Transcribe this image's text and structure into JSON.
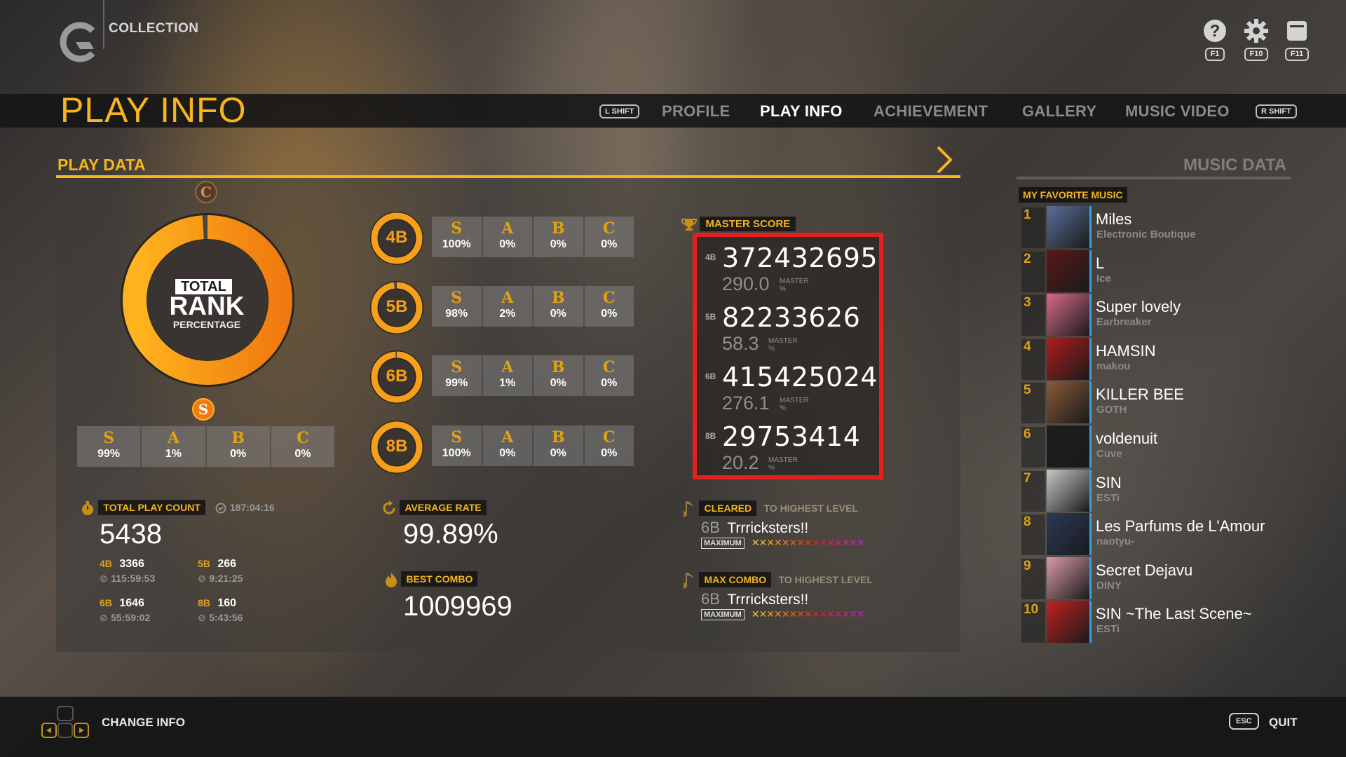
{
  "header": {
    "app_section": "COLLECTION",
    "page_title": "PLAY INFO",
    "hud": [
      {
        "icon": "help-icon",
        "key": "F1"
      },
      {
        "icon": "gear-icon",
        "key": "F10"
      },
      {
        "icon": "window-icon",
        "key": "F11"
      }
    ]
  },
  "nav": {
    "left_key": "L SHIFT",
    "right_key": "R SHIFT",
    "tabs": [
      "PROFILE",
      "PLAY INFO",
      "ACHIEVEMENT",
      "GALLERY",
      "MUSIC VIDEO"
    ],
    "active_tab": "PLAY INFO"
  },
  "play_data": {
    "title": "PLAY DATA",
    "total_rank": {
      "label_total": "TOTAL",
      "label_rank": "RANK",
      "label_percentage": "PERCENTAGE",
      "ring_fill_fraction": 0.99,
      "grades": [
        {
          "grade": "S",
          "pct": "99%"
        },
        {
          "grade": "A",
          "pct": "1%"
        },
        {
          "grade": "B",
          "pct": "0%"
        },
        {
          "grade": "C",
          "pct": "0%"
        }
      ]
    },
    "buttons": [
      {
        "mode": "4B",
        "fill": 1.0,
        "grades": [
          "100%",
          "0%",
          "0%",
          "0%"
        ]
      },
      {
        "mode": "5B",
        "fill": 0.98,
        "grades": [
          "98%",
          "2%",
          "0%",
          "0%"
        ]
      },
      {
        "mode": "6B",
        "fill": 0.99,
        "grades": [
          "99%",
          "1%",
          "0%",
          "0%"
        ]
      },
      {
        "mode": "8B",
        "fill": 1.0,
        "grades": [
          "100%",
          "0%",
          "0%",
          "0%"
        ]
      }
    ],
    "grade_letters": [
      "S",
      "A",
      "B",
      "C"
    ],
    "master_score": {
      "label": "MASTER SCORE",
      "rows": [
        {
          "mode": "4B",
          "score": "372432695",
          "level": "290.0",
          "tag": "MASTER",
          "unit": "%"
        },
        {
          "mode": "5B",
          "score": "82233626",
          "level": "58.3",
          "tag": "MASTER",
          "unit": "%"
        },
        {
          "mode": "6B",
          "score": "415425024",
          "level": "276.1",
          "tag": "MASTER",
          "unit": "%"
        },
        {
          "mode": "8B",
          "score": "29753414",
          "level": "20.2",
          "tag": "MASTER",
          "unit": "%"
        }
      ]
    },
    "total_play_count": {
      "label": "TOTAL PLAY COUNT",
      "total_time": "187:04:16",
      "value": "5438",
      "breakdown": [
        {
          "mode": "4B",
          "count": "3366",
          "time": "115:59:53"
        },
        {
          "mode": "5B",
          "count": "266",
          "time": "9:21:25"
        },
        {
          "mode": "6B",
          "count": "1646",
          "time": "55:59:02"
        },
        {
          "mode": "8B",
          "count": "160",
          "time": "5:43:56"
        }
      ]
    },
    "average_rate": {
      "label": "AVERAGE RATE",
      "value": "99.89%"
    },
    "best_combo": {
      "label": "BEST COMBO",
      "value": "1009969"
    },
    "cleared": {
      "label": "CLEARED",
      "sub": "TO HIGHEST LEVEL",
      "mode": "6B",
      "song": "Trrricksters!!",
      "difficulty": "MAXIMUM",
      "stars": 15
    },
    "max_combo": {
      "label": "MAX COMBO",
      "sub": "TO HIGHEST LEVEL",
      "mode": "6B",
      "song": "Trrricksters!!",
      "difficulty": "MAXIMUM",
      "stars": 15
    }
  },
  "music_data": {
    "title": "MUSIC DATA",
    "favorite_label": "MY FAVORITE MUSIC",
    "items": [
      {
        "rank": "1",
        "title": "Miles",
        "artist": "Electronic Boutique",
        "color": "#5a6f9a"
      },
      {
        "rank": "2",
        "title": "L",
        "artist": "Ice",
        "color": "#5a1818"
      },
      {
        "rank": "3",
        "title": "Super lovely",
        "artist": "Earbreaker",
        "color": "#d86a8a"
      },
      {
        "rank": "4",
        "title": "HAMSIN",
        "artist": "makou",
        "color": "#b01c1c"
      },
      {
        "rank": "5",
        "title": "KILLER BEE",
        "artist": "GOTH",
        "color": "#8a5a3a"
      },
      {
        "rank": "6",
        "title": "voldenuit",
        "artist": "Cuve",
        "color": "#1e1e1e"
      },
      {
        "rank": "7",
        "title": "SIN",
        "artist": "ESTi",
        "color": "#c8c8c8"
      },
      {
        "rank": "8",
        "title": "Les Parfums de L'Amour",
        "artist": "naotyu-",
        "color": "#2a3a5a"
      },
      {
        "rank": "9",
        "title": "Secret Dejavu",
        "artist": "DINY",
        "color": "#d89aa8"
      },
      {
        "rank": "10",
        "title": "SIN ~The Last Scene~",
        "artist": "ESTi",
        "color": "#c42020"
      }
    ]
  },
  "footer": {
    "change_info": "CHANGE INFO",
    "esc_key": "ESC",
    "quit": "QUIT"
  },
  "colors": {
    "accent": "#f6b51e",
    "highlight_box": "#e3201f"
  }
}
